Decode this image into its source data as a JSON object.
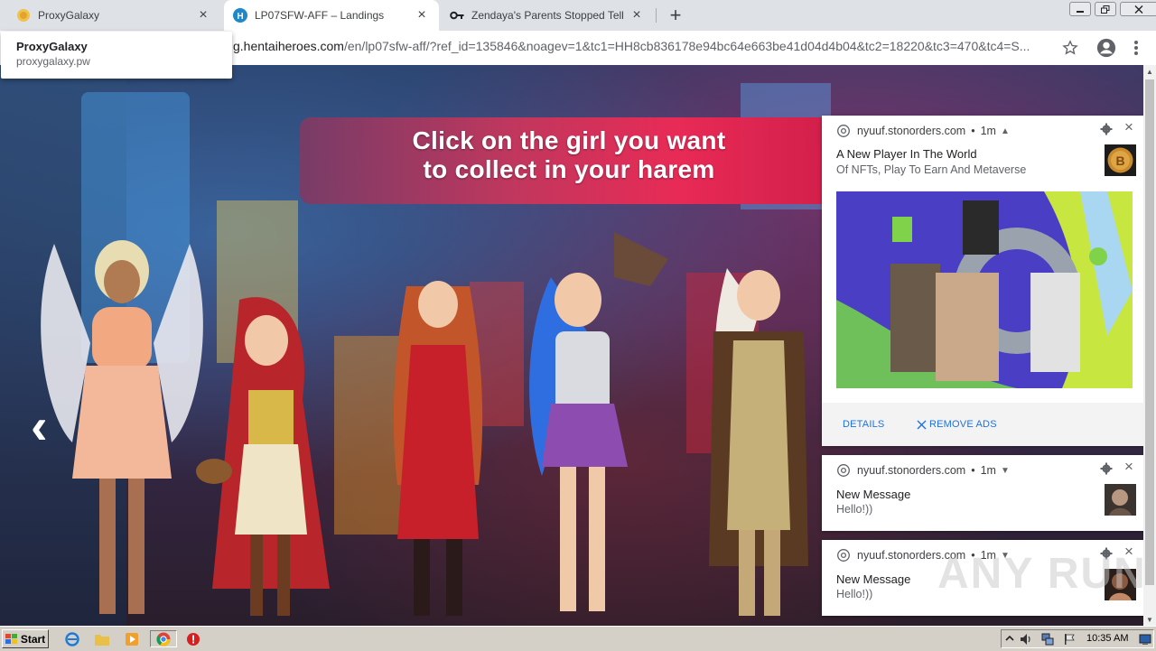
{
  "browser": {
    "tabs": [
      {
        "title": "ProxyGalaxy",
        "favicon": "proxygalaxy-favicon",
        "close": "×"
      },
      {
        "title": "LP07SFW-AFF – Landings",
        "favicon": "hentaiheroes-favicon",
        "close": "×",
        "active": true
      },
      {
        "title": "Zendaya's Parents Stopped Telling H",
        "favicon": "key-icon",
        "close": "×"
      }
    ],
    "new_tab": "+",
    "address": {
      "host": "g.hentaiheroes.com",
      "path": "/en/lp07sfw-aff/?ref_id=135846&noagev=1&tc1=HH8cb836178e94bc64e663be41d04d4b04&tc2=18220&tc3=470&tc4=S..."
    },
    "tab_card": {
      "title": "ProxyGalaxy",
      "subtitle": "proxygalaxy.pw"
    }
  },
  "page": {
    "banner": {
      "line1": "Click on the girl you want",
      "line2": "to collect in your harem"
    },
    "prev_arrow": "‹",
    "accent_color": "#ee2a55"
  },
  "notifications": [
    {
      "site": "nyuuf.stonorders.com",
      "dot": "•",
      "age": "1m",
      "chevron": "▲",
      "title": "A New Player In The World",
      "body": "Of NFTs, Play To Earn And Metaverse",
      "thumb": "bitcoin-coin",
      "has_image": true,
      "actions": [
        "DETAILS",
        "REMOVE ADS"
      ],
      "close": "×"
    },
    {
      "site": "nyuuf.stonorders.com",
      "dot": "•",
      "age": "1m",
      "chevron": "▼",
      "title": "New Message",
      "body": "Hello!))",
      "thumb": "avatar-photo",
      "close": "×"
    },
    {
      "site": "nyuuf.stonorders.com",
      "dot": "•",
      "age": "1m",
      "chevron": "▼",
      "title": "New Message",
      "body": "Hello!))",
      "thumb": "avatar-photo",
      "close": "×"
    }
  ],
  "taskbar": {
    "start_label": "Start",
    "clock": "10:35 AM"
  },
  "watermark": "ANY RUN"
}
